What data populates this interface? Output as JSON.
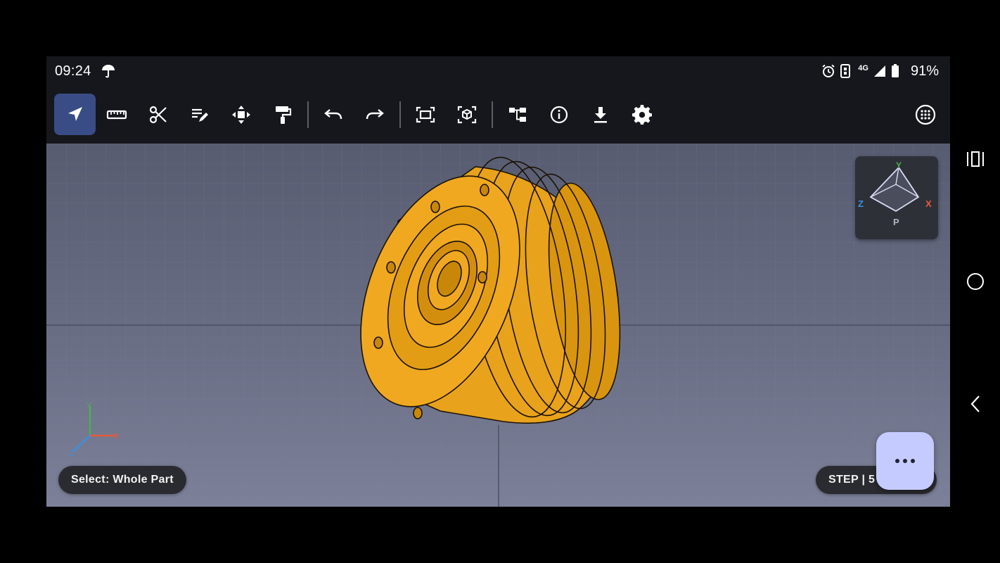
{
  "status_bar": {
    "time": "09:24",
    "left_icon": "umbrella-icon",
    "right_icons": [
      "alarm-icon",
      "data-saver-icon",
      "network-4g-icon",
      "signal-icon",
      "battery-icon"
    ],
    "network_label": "4G",
    "battery": "91%"
  },
  "toolbar": {
    "tools": [
      {
        "name": "select-tool",
        "icon": "navigation-arrow-icon",
        "active": true
      },
      {
        "name": "measure-tool",
        "icon": "ruler-icon",
        "active": false
      },
      {
        "name": "section-tool",
        "icon": "scissors-icon",
        "active": false
      },
      {
        "name": "annotate-tool",
        "icon": "edit-list-icon",
        "active": false
      },
      {
        "name": "move-tool",
        "icon": "move-arrows-icon",
        "active": false
      },
      {
        "name": "paint-tool",
        "icon": "paint-roller-icon",
        "active": false
      },
      {
        "name": "undo-button",
        "icon": "undo-icon",
        "active": false
      },
      {
        "name": "redo-button",
        "icon": "redo-icon",
        "active": false
      },
      {
        "name": "fit-view-button",
        "icon": "fit-screen-icon",
        "active": false
      },
      {
        "name": "view-3d-button",
        "icon": "cube-frame-icon",
        "active": false
      },
      {
        "name": "tree-button",
        "icon": "hierarchy-icon",
        "active": false
      },
      {
        "name": "info-button",
        "icon": "info-icon",
        "active": false
      },
      {
        "name": "download-button",
        "icon": "download-icon",
        "active": false
      },
      {
        "name": "settings-button",
        "icon": "gear-icon",
        "active": false
      },
      {
        "name": "grid-toggle-button",
        "icon": "grid-dots-icon",
        "active": false
      }
    ],
    "accent": "#3a4c86"
  },
  "viewport": {
    "model_color": "#f0a820",
    "background_top": "#575c71",
    "background_bottom": "#7c8098"
  },
  "view_cube": {
    "axis_y": "Y",
    "axis_x": "X",
    "axis_z": "Z",
    "projection": "P",
    "color_y": "#4caf50",
    "color_x": "#e65a3a",
    "color_z": "#3d8fe0"
  },
  "axis_triad": {
    "label_x": "X",
    "label_y": "Y",
    "label_z": "Z"
  },
  "selection_pill": {
    "text": "Select: Whole Part"
  },
  "format_pill": {
    "text": "STEP | 5"
  },
  "fab": {
    "icon": "more-horizontal-icon",
    "color": "#c6cbff"
  },
  "system_nav": {
    "buttons": [
      "recents-icon",
      "home-icon",
      "back-icon"
    ]
  }
}
